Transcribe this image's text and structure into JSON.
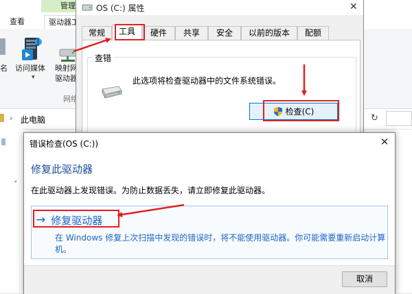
{
  "explorer": {
    "context_tab": "管理",
    "tabs": [
      "查看",
      "驱动器工"
    ],
    "ribbon": {
      "left_label_1": "名",
      "left_label_2": "",
      "access_media": "访问媒体",
      "map_network_line1": "映射网",
      "map_network_line2": "驱动器",
      "group_label": "网络"
    },
    "address": {
      "path": "此电脑"
    }
  },
  "properties": {
    "title": "OS (C:) 属性",
    "tabs": [
      "常规",
      "工具",
      "硬件",
      "共享",
      "安全",
      "以前的版本",
      "配额"
    ],
    "active_tab": "工具",
    "group_title": "查错",
    "group_text": "此选项将检查驱动器中的文件系统错误。",
    "check_button": "检查(C)"
  },
  "dialog": {
    "title": "错误检查(OS (C:))",
    "heading": "修复此驱动器",
    "message": "在此驱动器上发现错误。为防止数据丢失，请立即修复此驱动器。",
    "command_link": {
      "title": "修复驱动器",
      "description": "在 Windows 修复上次扫描中发现的错误时，将不能使用驱动器。你可能需要重新启动计算机。"
    },
    "cancel_button": "取消"
  },
  "colors": {
    "highlight": "#e02020",
    "link_blue": "#1e64c8",
    "heading_blue": "#1e4e9b",
    "ribbon_context": "#d6eec6"
  }
}
